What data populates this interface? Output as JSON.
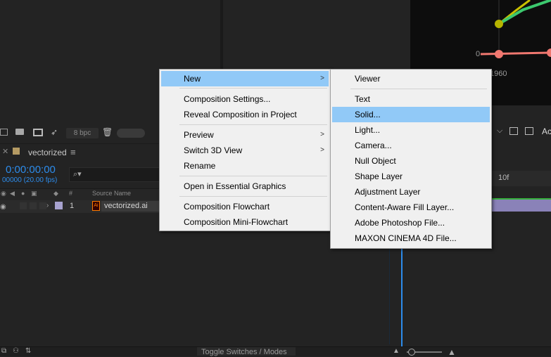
{
  "graph": {
    "y_zero_label": "0",
    "x_year_label": "1960"
  },
  "project_toolbar": {
    "bpc": "8 bpc"
  },
  "composition": {
    "title": "vectorized",
    "timecode": "0:00:00:00",
    "frames": "00000 (20.00 fps)"
  },
  "layer_header": {
    "hash": "#",
    "source_name": "Source Name"
  },
  "layer": {
    "number": "1",
    "name": "vectorized.ai",
    "ai_glyph": "Ai"
  },
  "timeline": {
    "ruler_mark": "10f",
    "toolbar_text": "Ac"
  },
  "bottom": {
    "toggle_label": "Toggle Switches / Modes"
  },
  "context_menu": {
    "items": [
      {
        "label": "New",
        "submenu": true
      },
      {
        "label": "Composition Settings..."
      },
      {
        "label": "Reveal Composition in Project"
      },
      {
        "label": "Preview",
        "submenu": true
      },
      {
        "label": "Switch 3D View",
        "submenu": true
      },
      {
        "label": "Rename"
      },
      {
        "label": "Open in Essential Graphics"
      },
      {
        "label": "Composition Flowchart"
      },
      {
        "label": "Composition Mini-Flowchart"
      }
    ]
  },
  "submenu": {
    "items": [
      {
        "label": "Viewer"
      },
      {
        "label": "Text"
      },
      {
        "label": "Solid..."
      },
      {
        "label": "Light..."
      },
      {
        "label": "Camera..."
      },
      {
        "label": "Null Object"
      },
      {
        "label": "Shape Layer"
      },
      {
        "label": "Adjustment Layer"
      },
      {
        "label": "Content-Aware Fill Layer..."
      },
      {
        "label": "Adobe Photoshop File..."
      },
      {
        "label": "MAXON CINEMA 4D File..."
      }
    ]
  },
  "colors": {
    "highlight": "#91c9f7",
    "timecode_blue": "#2d8ceb",
    "menu_bg": "#f0f0f0"
  }
}
